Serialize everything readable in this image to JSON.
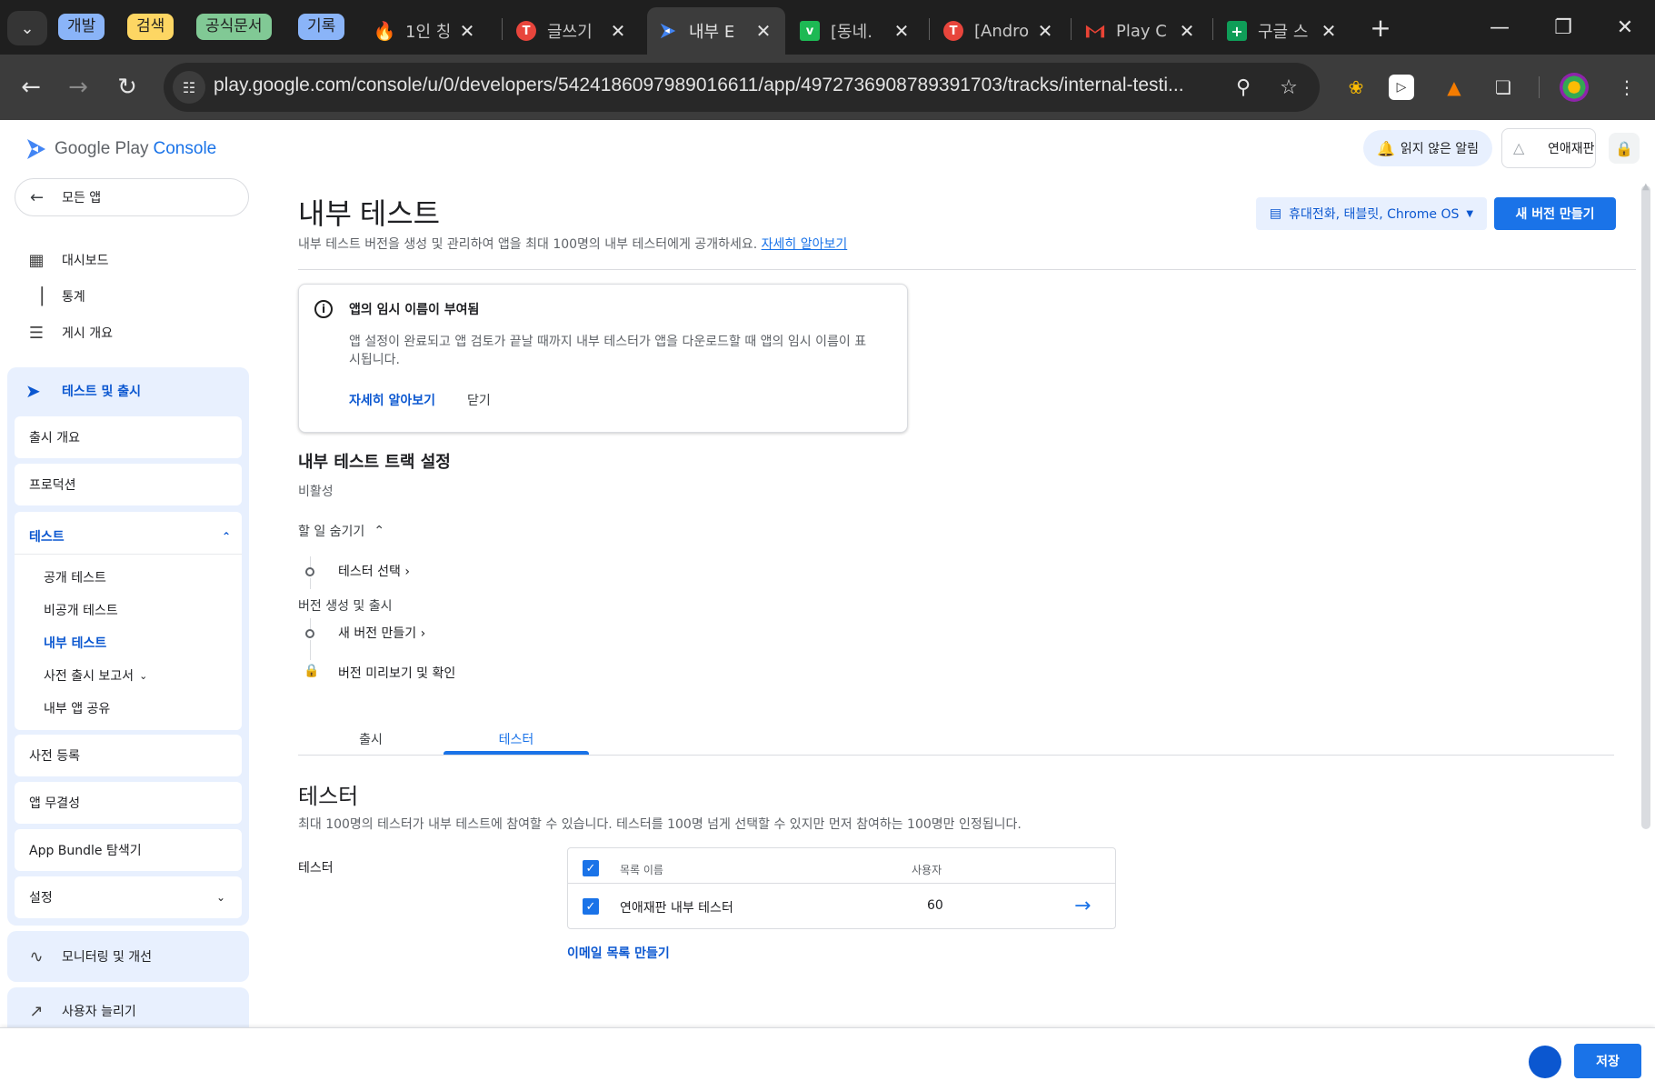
{
  "browser": {
    "groups": [
      {
        "label": "개발",
        "color": "#8ab4f8"
      },
      {
        "label": "검색",
        "color": "#fdd663"
      },
      {
        "label": "공식문서",
        "color": "#81c995"
      },
      {
        "label": "기록",
        "color": "#8ab4f8"
      }
    ],
    "tabs": [
      {
        "title": "1인 칭",
        "icon": "fire-icon"
      },
      {
        "title": "글쓰기",
        "icon": "brand-t-icon"
      },
      {
        "title": "내부 E",
        "icon": "play-console-icon",
        "active": true
      },
      {
        "title": "[동네․",
        "icon": "v-icon"
      },
      {
        "title": "[Andro",
        "icon": "brand-t-icon"
      },
      {
        "title": "Play C",
        "icon": "gmail-icon"
      },
      {
        "title": "구글 스",
        "icon": "sheets-icon"
      }
    ],
    "url": "play.google.com/console/u/0/developers/5424186097989016611/app/4972736908789391703/tracks/internal-testi..."
  },
  "header": {
    "logo_text": "Google Play",
    "logo_bold": "Console",
    "notifications": "읽지 않은 알림",
    "account": "연애재판"
  },
  "sidebar": {
    "all_apps": "모든 앱",
    "top_items": [
      {
        "label": "대시보드",
        "icon": "dashboard-icon"
      },
      {
        "label": "통계",
        "icon": "bar-chart-icon"
      },
      {
        "label": "게시 개요",
        "icon": "publishing-icon"
      }
    ],
    "test_release": "테스트 및 출시",
    "release_overview": "출시 개요",
    "production": "프로덕션",
    "testing": "테스트",
    "testing_items": [
      "공개 테스트",
      "비공개 테스트",
      "내부 테스트",
      "사전 출시 보고서",
      "내부 앱 공유"
    ],
    "pre_registration": "사전 등록",
    "app_integrity": "앱 무결성",
    "bundle_explorer": "App Bundle 탐색기",
    "settings": "설정",
    "monitoring": "모니터링 및 개선",
    "grow_users": "사용자 늘리기"
  },
  "main": {
    "title": "내부 테스트",
    "description": "내부 테스트 버전을 생성 및 관리하여 앱을 최대 100명의 내부 테스터에게 공개하세요.",
    "learn_more": "자세히 알아보기",
    "device_selector": "휴대전화, 태블릿, Chrome OS",
    "new_release_button": "새 버전 만들기",
    "info": {
      "title": "앱의 임시 이름이 부여됨",
      "body": "앱 설정이 완료되고 앱 검토가 끝날 때까지 내부 테스터가 앱을 다운로드할 때 앱의 임시 이름이 표시됩니다.",
      "learn": "자세히 알아보기",
      "close": "닫기"
    },
    "track_heading": "내부 테스트 트랙 설정",
    "track_status": "비활성",
    "todo_toggle": "할 일 숨기기",
    "step_select_testers": "테스터 선택",
    "group_release": "버전 생성 및 출시",
    "step_new_release": "새 버전 만들기",
    "step_preview": "버전 미리보기 및 확인",
    "tabs": [
      "출시",
      "테스터"
    ],
    "testers_heading": "테스터",
    "testers_desc": "최대 100명의 테스터가 내부 테스트에 참여할 수 있습니다. 테스터를 100명 넘게 선택할 수 있지만 먼저 참여하는 100명만 인정됩니다.",
    "testers_label": "테스터",
    "table": {
      "col_name": "목록 이름",
      "col_users": "사용자",
      "rows": [
        {
          "name": "연애재판 내부 테스터",
          "users": "60",
          "checked": true
        }
      ]
    },
    "create_email_list": "이메일 목록 만들기"
  },
  "footer": {
    "save": "저장"
  }
}
